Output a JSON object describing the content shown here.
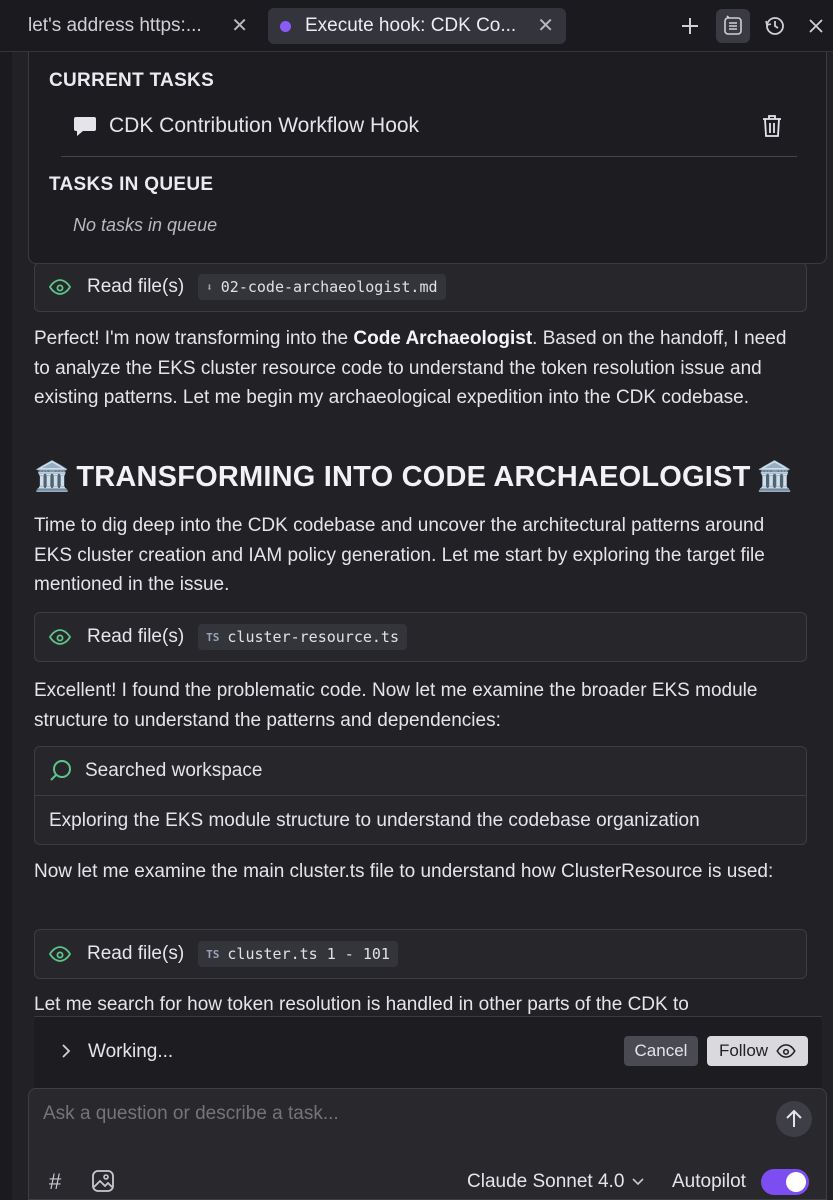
{
  "tabs": [
    {
      "label": "let's address https:...",
      "active": false
    },
    {
      "label": "Execute hook: CDK Co...",
      "active": true
    }
  ],
  "toolbar": {
    "new_icon": "plus-icon",
    "tasks_icon": "task-list-icon",
    "history_icon": "history-icon",
    "close_icon": "close-icon"
  },
  "task_panel": {
    "current_title": "CURRENT TASKS",
    "current_task": "CDK Contribution Workflow Hook",
    "queue_title": "TASKS IN QUEUE",
    "queue_empty": "No tasks in queue"
  },
  "chat": {
    "read1": {
      "label": "Read file(s)",
      "file": "02-code-archaeologist.md"
    },
    "para1_pre": "Perfect! I'm now transforming into the ",
    "para1_bold": "Code Archaeologist",
    "para1_post": ". Based on the handoff, I need to analyze the EKS cluster resource code to understand the token resolution issue and existing patterns. Let me begin my archaeological expedition into the CDK codebase.",
    "heading": "TRANSFORMING INTO CODE ARCHAEOLOGIST",
    "heading_emoji": "🏛️",
    "para2": "Time to dig deep into the CDK codebase and uncover the architectural patterns around EKS cluster creation and IAM policy generation. Let me start by exploring the target file mentioned in the issue.",
    "read2": {
      "label": "Read file(s)",
      "file": "cluster-resource.ts",
      "badge": "TS"
    },
    "para3": "Excellent! I found the problematic code. Now let me examine the broader EKS module structure to understand the patterns and dependencies:",
    "search": {
      "label": "Searched workspace",
      "detail": "Exploring the EKS module structure to understand the codebase organization"
    },
    "para4": "Now let me examine the main cluster.ts file to understand how ClusterResource is used:",
    "read3": {
      "label": "Read file(s)",
      "file": "cluster.ts 1 - 101",
      "badge": "TS"
    },
    "para5": "Let me search for how token resolution is handled in other parts of the CDK to"
  },
  "working": {
    "label": "Working...",
    "cancel": "Cancel",
    "follow": "Follow"
  },
  "composer": {
    "placeholder": "Ask a question or describe a task...",
    "hash": "#",
    "model": "Claude Sonnet 4.0",
    "autopilot_label": "Autopilot",
    "autopilot_on": true
  },
  "colors": {
    "accent": "#7c4df0",
    "active_dot": "#8a5cf6",
    "eye_green": "#5fc48a"
  }
}
